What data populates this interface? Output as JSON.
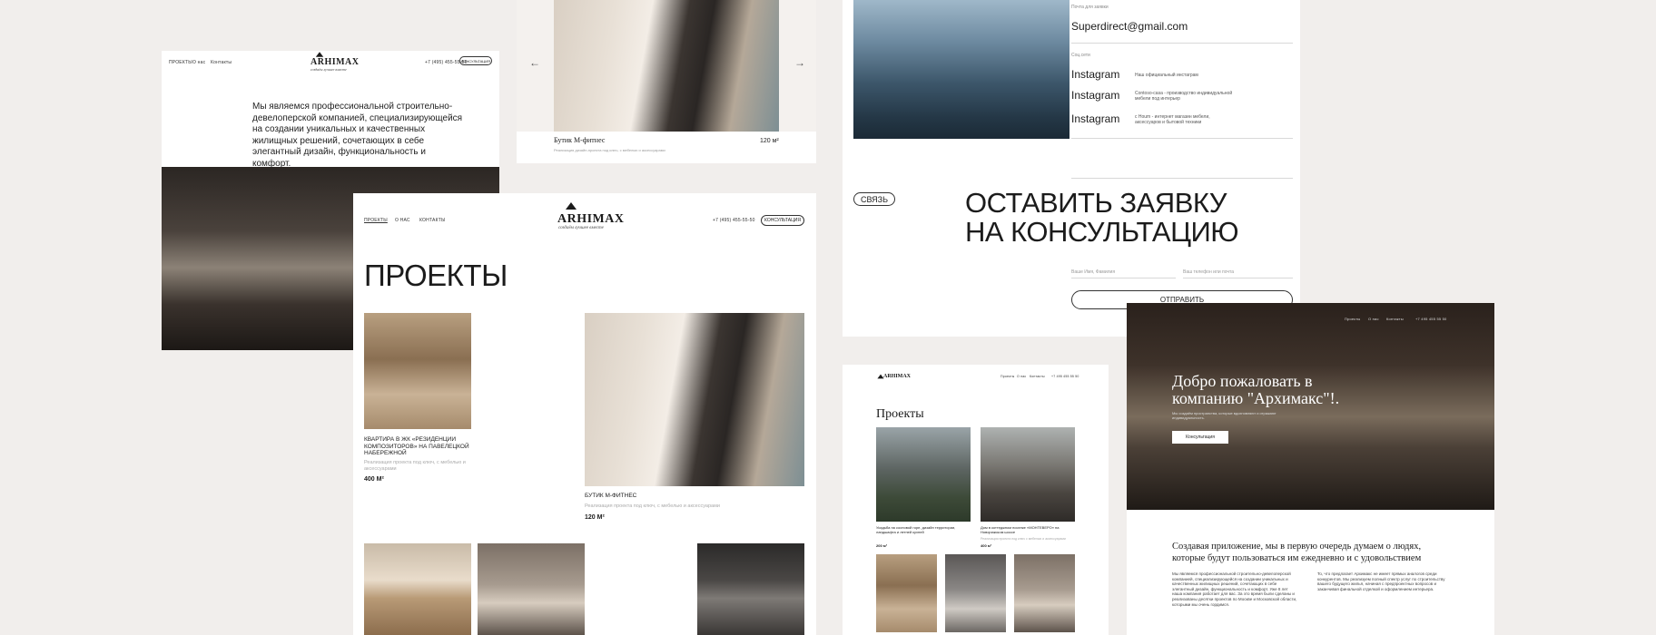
{
  "brand": {
    "name": "ARHIMAX",
    "tagline": "создаём лучшее вместе"
  },
  "nav": {
    "projects": "ПРОЕКТЫ",
    "about": "О нас",
    "contacts": "Контакты",
    "projects_upper": "ПРОЕКТЫ",
    "about_upper": "О НАС",
    "contacts_upper": "КОНТАКТЫ"
  },
  "phone": "+7 (495) 455-55-50",
  "consult_btn": "КОНСУЛЬТАЦИЯ",
  "about_card": {
    "text": "Мы являемся профессиональной строительно-девелоперской компанией, специализирующейся на создании уникальных и качественных жилищных решений, сочетающих в себе элегантный дизайн, функциональность и комфорт."
  },
  "slider_card": {
    "title": "Бутик М-фитнес",
    "area": "120 м²",
    "desc": "Реализация дизайн-проекта под ключ, с мебелью и аксессуарами",
    "prev": "←",
    "next": "→"
  },
  "contacts_card": {
    "email_label": "Почта для заявки",
    "email": "Superdirect@gmail.com",
    "social_label": "Соц.сети",
    "socials": [
      {
        "name": "Instagram",
        "desc": "Наш официальный инстаграм"
      },
      {
        "name": "Instagram",
        "desc": "Contoso-casa - производство индивидуальной мебели под интерьер"
      },
      {
        "name": "Instagram",
        "desc": "с Houm - интернет магазин мебели, аксессуаров и бытовой техники"
      }
    ],
    "link_btn": "СВЯЗЬ",
    "heading_line1": "ОСТАВИТЬ ЗАЯВКУ",
    "heading_line2": "НА КОНСУЛЬТАЦИЮ",
    "name_placeholder": "Ваше Имя, Фамилия",
    "phone_placeholder": "Ваш телефон или почта",
    "submit": "ОТПРАВИТЬ"
  },
  "projects_page": {
    "heading": "ПРОЕКТЫ",
    "items": [
      {
        "title": "КВАРТИРА В ЖК «РЕЗИДЕНЦИИ КОМПОЗИТОРОВ» НА ПАВЕЛЕЦКОЙ НАБЕРЕЖНОЙ",
        "desc": "Реализация проекта под ключ, с мебелью и аксессуарами",
        "area": "400 М²"
      },
      {
        "title": "БУТИК М-ФИТНЕС",
        "desc": "Реализация проекта под ключ, с мебелью и аксессуарами",
        "area": "120 М²"
      }
    ]
  },
  "mobile_projects": {
    "logo": "ARHIMAX",
    "nav": [
      "Проекты",
      "О нас",
      "Контакты",
      "+7 495 455 55 50"
    ],
    "heading": "Проекты",
    "items": [
      {
        "title": "Усадьба на сосновой горе, дизайн территории, ландшафта и летней кухней",
        "area": "200 м²"
      },
      {
        "title": "Дом в коттеджном поселке «МОНТЕВЕРО» на Новорижском шоссе",
        "desc": "Реализация проекта под ключ с мебелью и аксессуарами",
        "area": "400 м²"
      }
    ]
  },
  "landing": {
    "nav": [
      "Проекты",
      "О нас",
      "Контакты",
      "+7 495 455 55 50"
    ],
    "hero_title_1": "Добро пожаловать в",
    "hero_title_2": "компанию \"Архимакс\"!.",
    "hero_sub": "Мы создаём пространства, которые вдохновляют и отражают индивидуальность.",
    "hero_btn": "Консультация",
    "intro_1": "Создавая приложение, мы в первую очередь думаем о людях,",
    "intro_2": "которые будут пользоваться им ежедневно и с удовольствием",
    "col1": "Мы являемся профессиональной строительно-девелоперской компанией, специализирующейся на создании уникальных и качественных жилищных решений, сочетающих в себе элегантный дизайн, функциональность и комфорт. Уже 8 лет наша компания работает для вас. За это время были сделаны и реализованы десятки проектов по Москве и Московской области, которыми мы очень гордимся.",
    "col2": "То, что предлагает Архимакс не имеет прямых аналогов среди конкурентов. Мы реализуем полный спектр услуг по строительству вашего будущего жилья, начиная с предпроектных вопросов и заканчивая финальной отделкой и оформлением интерьера."
  }
}
